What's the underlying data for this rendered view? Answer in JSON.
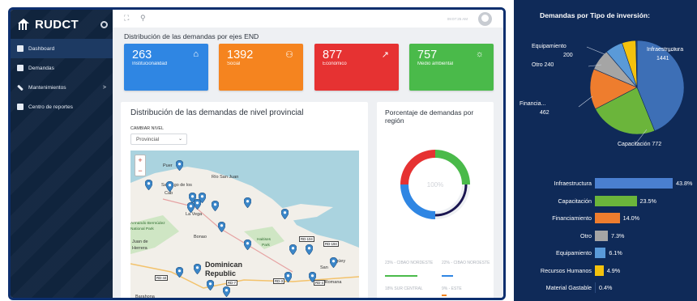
{
  "app": {
    "brand": "RUDCT"
  },
  "sidebar": {
    "items": [
      {
        "label": "Dashboard",
        "icon": "home-icon",
        "active": true
      },
      {
        "label": "Demandas",
        "icon": "book-icon"
      },
      {
        "label": "Mantenimientos",
        "icon": "wrench-icon",
        "chevron": ">"
      },
      {
        "label": "Centro de reportes",
        "icon": "print-icon"
      }
    ]
  },
  "topbar": {
    "user": "09:07:25 AM"
  },
  "main": {
    "section_title": "Distribución de las demandas por ejes END",
    "cards": [
      {
        "value": "263",
        "label": "Institucionalidad",
        "color": "#2f86e3",
        "icon": "⌂"
      },
      {
        "value": "1392",
        "label": "Social",
        "color": "#f5841f",
        "icon": "⚇"
      },
      {
        "value": "877",
        "label": "Económico",
        "color": "#e63232",
        "icon": "↗"
      },
      {
        "value": "757",
        "label": "Medio ambiental",
        "color": "#4aba4a",
        "icon": "☼"
      }
    ],
    "map_panel": {
      "title": "Distribución de las demandas de nivel provincial",
      "nivel_label": "CAMBIAR NIVEL",
      "select_value": "Provincial",
      "zoom_in": "+",
      "zoom_out": "−",
      "labels": {
        "puerto": "Puer",
        "san_juan": "Río San Juan",
        "santiago": "Santiago de los",
        "caba": "Cab",
        "lavega": "La Vega",
        "bermudez": "Armando Bermúdez",
        "np": "National Park",
        "bonao": "Bonao",
        "juande": "Juan de",
        "herrera": "Herrera",
        "haitises": "Haitises",
        "park": "Park",
        "dominican": "Dominican",
        "republic": "Republic",
        "sanrafael": "San",
        "higuey": "Higüey",
        "romana": "La Romana",
        "barahona": "Barahona",
        "rd44": "RD-44",
        "rd104": "RD-104",
        "rd3": "RD-3",
        "rd4": "RD-4",
        "rd7": "RD-7",
        "rd194": "RD-194"
      }
    },
    "region_panel": {
      "title": "Porcentaje de demandas por región",
      "center": "100%",
      "legend": [
        {
          "label": "23% - CIBAO NORDESTE",
          "color": "#4aba4a"
        },
        {
          "label": "22% - CIBAO NOROESTE",
          "color": "#2f86e3"
        },
        {
          "label": "18% SUR CENTRAL",
          "color": "#2f86e3"
        },
        {
          "label": "9% - ESTE",
          "color": "#f5841f"
        }
      ]
    }
  },
  "chart_data": [
    {
      "type": "pie",
      "title": "Demandas por Tipo de inversión:",
      "slices": [
        {
          "label": "Infraestructura",
          "value": 1441,
          "color": "#3d6fb6"
        },
        {
          "label": "Capacitación",
          "value": 772,
          "color": "#6bb53b"
        },
        {
          "label": "Financia...",
          "value": 462,
          "color": "#ee7d2e"
        },
        {
          "label": "Otro",
          "value": 240,
          "color": "#a5a5a5"
        },
        {
          "label": "Equipamiento",
          "value": 200,
          "color": "#5a9ad8"
        },
        {
          "label": "Recursos Humanos",
          "value": 157,
          "color": "#f4c20d"
        },
        {
          "label": "Material Gastable",
          "value": 13,
          "color": "#2a4a7d"
        }
      ],
      "labels": {
        "equip": "Equipamiento",
        "equip_val": "200",
        "otro": "Otro 240",
        "infra": "Infraestructura",
        "infra_val": "1441",
        "finan": "Financia...",
        "finan_val": "462",
        "capac": "Capacitación 772"
      }
    },
    {
      "type": "bar",
      "orientation": "horizontal",
      "categories": [
        "Infraestructura",
        "Capacitación",
        "Financiamiento",
        "Otro",
        "Equipamiento",
        "Recursos Humanos",
        "Material Gastable"
      ],
      "values": [
        43.8,
        23.5,
        14.0,
        7.3,
        6.1,
        4.9,
        0.4
      ],
      "value_labels": [
        "43.8%",
        "23.5%",
        "14.0%",
        "7.3%",
        "6.1%",
        "4.9%",
        "0.4%"
      ],
      "colors": [
        "#4a7fd0",
        "#6bb53b",
        "#ee7d2e",
        "#a5a5a5",
        "#5a9ad8",
        "#f4c20d",
        "#2a4a7d"
      ],
      "xlim": [
        0,
        43.8
      ]
    }
  ]
}
